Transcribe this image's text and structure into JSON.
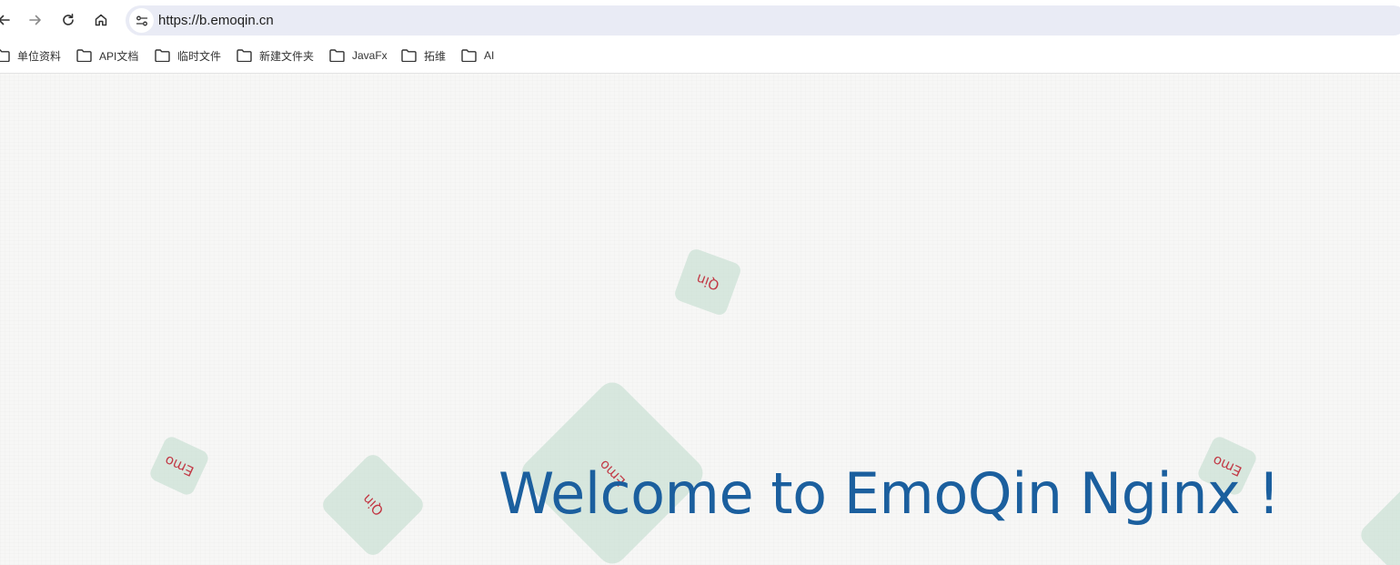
{
  "browser": {
    "url": "https://b.emoqin.cn",
    "nav_icons": [
      "back-arrow-icon",
      "forward-arrow-icon",
      "reload-icon",
      "home-icon",
      "site-info-icon"
    ]
  },
  "bookmarks": [
    {
      "label": "单位资料",
      "icon": "folder-icon"
    },
    {
      "label": "API文档",
      "icon": "folder-icon"
    },
    {
      "label": "临时文件",
      "icon": "folder-icon"
    },
    {
      "label": "新建文件夹",
      "icon": "folder-icon"
    },
    {
      "label": "JavaFx",
      "icon": "folder-icon"
    },
    {
      "label": "拓维",
      "icon": "folder-icon"
    },
    {
      "label": "AI",
      "icon": "folder-icon"
    }
  ],
  "page": {
    "heading": "Welcome to EmoQin Nginx !",
    "tiles": [
      {
        "text": "Qin"
      },
      {
        "text": "Emo"
      },
      {
        "text": "Qin"
      },
      {
        "text": "Emo"
      },
      {
        "text": "Emo"
      },
      {
        "text": ""
      }
    ]
  },
  "colors": {
    "heading": "#1b5f9e",
    "tile_fill": "#c4ddcf",
    "tile_text": "#c23a46",
    "address_bar": "#e9ebf5",
    "page_background": "#f7f7f6"
  }
}
